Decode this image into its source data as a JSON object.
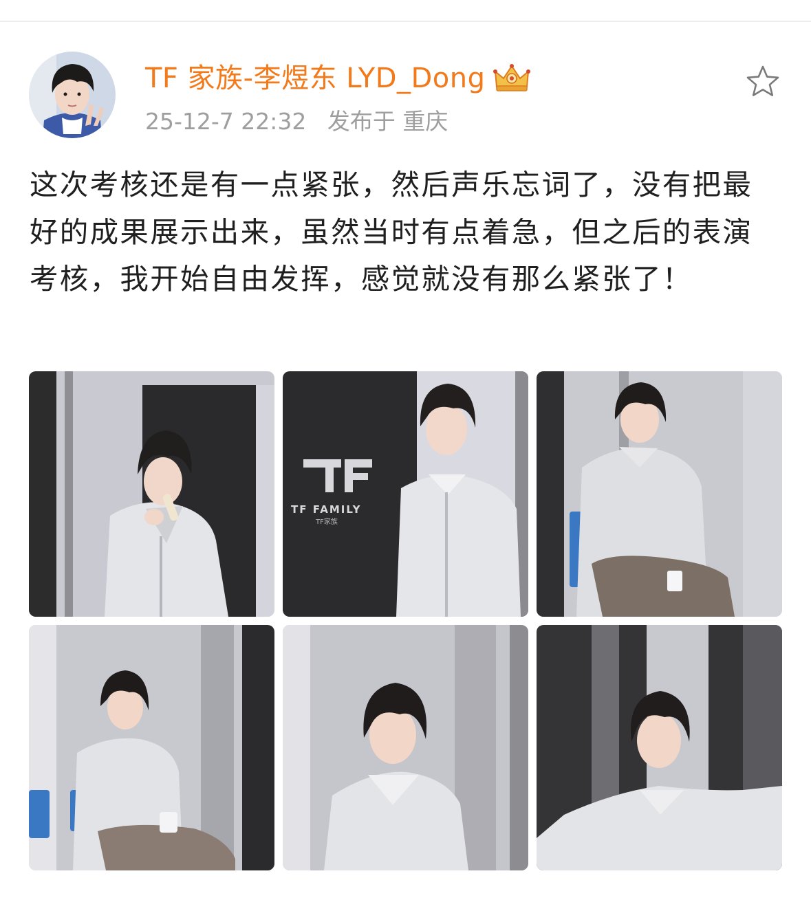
{
  "post": {
    "author": {
      "name": "TF 家族-李煜东 LYD_Dong",
      "badge_icon": "crown-icon"
    },
    "timestamp": "25-12-7 22:32",
    "location": "发布于 重庆",
    "text": "这次考核还是有一点紧张，然后声乐忘词了，没有把最好的成果展示出来，虽然当时有点着急，但之后的表演考核，我开始自由发挥，感觉就没有那么紧张了！",
    "photos": [
      {
        "label": "photo-1"
      },
      {
        "label": "photo-2",
        "logo_text": "TF FAMILY",
        "logo_sub": "TF家族"
      },
      {
        "label": "photo-3"
      },
      {
        "label": "photo-4"
      },
      {
        "label": "photo-5"
      },
      {
        "label": "photo-6"
      }
    ]
  },
  "actions": {
    "favorite_icon": "star-outline-icon"
  },
  "colors": {
    "username": "#f27a1b",
    "meta": "#9e9e9e",
    "text": "#1f1f1f"
  }
}
